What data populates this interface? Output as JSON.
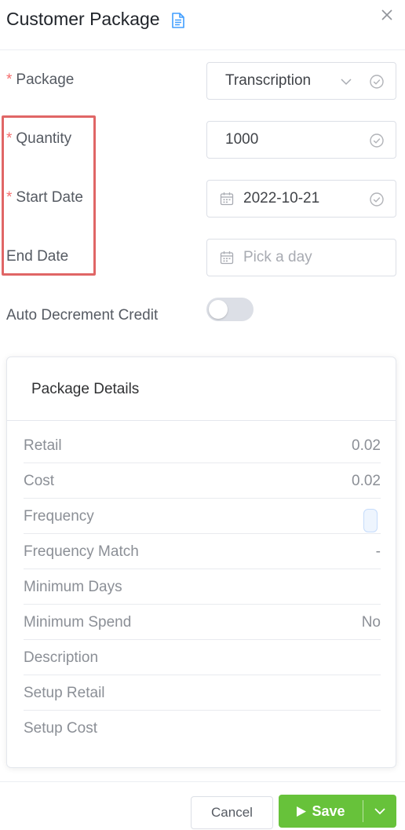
{
  "header": {
    "title": "Customer Package",
    "icons": {
      "title_icon": "document-icon",
      "close": "close-icon"
    }
  },
  "form": {
    "package": {
      "label": "Package",
      "required": true,
      "value": "Transcription"
    },
    "quantity": {
      "label": "Quantity",
      "required": true,
      "value": "1000"
    },
    "start_date": {
      "label": "Start Date",
      "required": true,
      "value": "2022-10-21"
    },
    "end_date": {
      "label": "End Date",
      "required": false,
      "value": "",
      "placeholder": "Pick a day"
    },
    "auto_decrement": {
      "label": "Auto Decrement Credit",
      "enabled": false
    },
    "required_marker": "*"
  },
  "package_details": {
    "title": "Package Details",
    "rows": [
      {
        "label": "Retail",
        "value": "0.02"
      },
      {
        "label": "Cost",
        "value": "0.02"
      },
      {
        "label": "Frequency",
        "value": ""
      },
      {
        "label": "Frequency Match",
        "value": "-"
      },
      {
        "label": "Minimum Days",
        "value": ""
      },
      {
        "label": "Minimum Spend",
        "value": "No"
      },
      {
        "label": "Description",
        "value": ""
      },
      {
        "label": "Setup Retail",
        "value": ""
      },
      {
        "label": "Setup Cost",
        "value": ""
      }
    ]
  },
  "footer": {
    "cancel_label": "Cancel",
    "save_label": "Save"
  },
  "colors": {
    "required": "#f56c6c",
    "highlight": "#e06666",
    "primary_success": "#67c23a",
    "accent_blue": "#409eff"
  }
}
